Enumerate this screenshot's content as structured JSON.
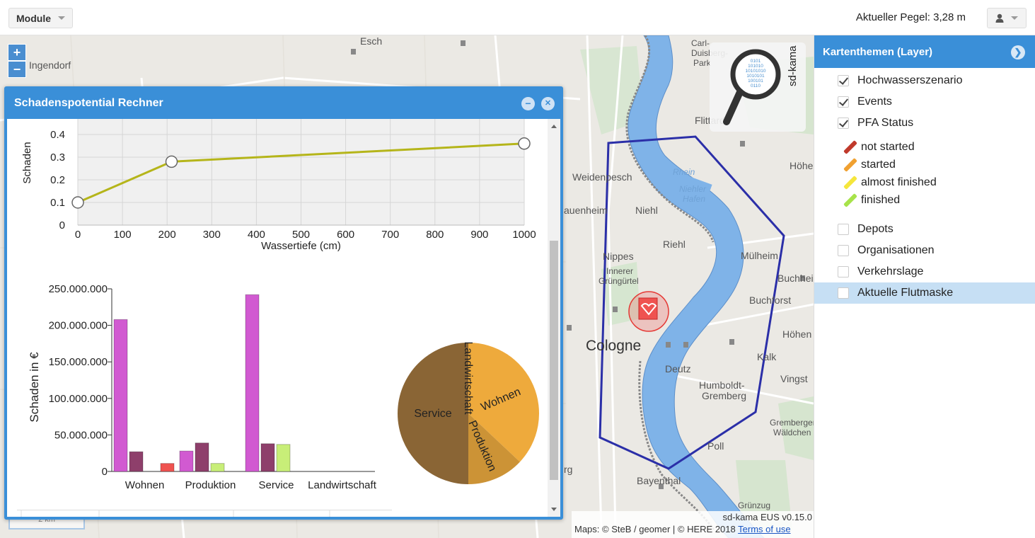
{
  "topbar": {
    "module_label": "Module",
    "pegel": "Aktueller Pegel: 3,28 m"
  },
  "map": {
    "zoom_in": "+",
    "zoom_out": "−",
    "labels": [
      "Esch",
      "Ingendorf",
      "Carl-",
      "Duisberg-",
      "Park",
      "Flittard",
      "Weidenpesch",
      "Höhe",
      "Niehl",
      "auenheim",
      "Riehl",
      "Mülheim",
      "Nippes",
      "Buchheim",
      "Innerer",
      "Grüngürtel",
      "Buchforst",
      "Cologne",
      "Höhen",
      "Kalk",
      "Deutz",
      "Humboldt-",
      "Gremberg",
      "Vingst",
      "Poll",
      "Gremberger",
      "Wäldchen",
      "rg",
      "Bayenthal",
      "Grünzug"
    ],
    "water_labels": [
      "Rhein",
      "Niehler",
      "Hafen"
    ],
    "brand": "sd-kama",
    "version": "sd-kama EUS v0.15.0",
    "attribution": "Maps: © SteB / geomer | © HERE 2018",
    "terms_link": "Terms of use",
    "scale": "2 km"
  },
  "panel": {
    "title": "Kartenthemen (Layer)",
    "layers_top": [
      {
        "label": "Hochwasserszenario",
        "checked": true
      },
      {
        "label": "Events",
        "checked": true
      },
      {
        "label": "PFA Status",
        "checked": true
      }
    ],
    "legend": [
      {
        "label": "not started",
        "color": "#c0392b"
      },
      {
        "label": "started",
        "color": "#f0a030"
      },
      {
        "label": "almost finished",
        "color": "#f5e63c"
      },
      {
        "label": "finished",
        "color": "#a7e34a"
      }
    ],
    "layers_bottom": [
      {
        "label": "Depots",
        "checked": false
      },
      {
        "label": "Organisationen",
        "checked": false
      },
      {
        "label": "Verkehrslage",
        "checked": false
      },
      {
        "label": "Aktuelle Flutmaske",
        "checked": false
      }
    ]
  },
  "dialog": {
    "title": "Schadenspotential Rechner",
    "minimize": "−",
    "close": "✕"
  },
  "chart_data": [
    {
      "type": "line",
      "xlabel": "Wassertiefe (cm)",
      "ylabel": "Schaden",
      "x": [
        0,
        210,
        1000
      ],
      "y": [
        0.1,
        0.28,
        0.36
      ],
      "xlim": [
        0,
        1000
      ],
      "ylim": [
        0,
        0.5
      ],
      "xticks": [
        0,
        100,
        200,
        300,
        400,
        500,
        600,
        700,
        800,
        900,
        1000
      ],
      "yticks": [
        0,
        0.1,
        0.2,
        0.3,
        0.4,
        0.5
      ],
      "color": "#b5b51a"
    },
    {
      "type": "bar",
      "ylabel": "Schaden in €",
      "categories": [
        "Wohnen",
        "Produktion",
        "Service",
        "Landwirtschaft"
      ],
      "series": [
        {
          "values": [
            208000000,
            28000000,
            242000000,
            0
          ],
          "color": "#d15ad1"
        },
        {
          "values": [
            27000000,
            39000000,
            38000000,
            0
          ],
          "color": "#8e3f6b"
        },
        {
          "values": [
            0,
            11000000,
            37000000,
            0
          ],
          "color": "#c8ee78"
        },
        {
          "values": [
            11000000,
            0,
            0,
            0
          ],
          "color": "#ef5350"
        }
      ],
      "ylim": [
        0,
        250000000
      ],
      "yticks": [
        0,
        50000000,
        100000000,
        150000000,
        200000000,
        250000000
      ],
      "ytick_labels": [
        "0",
        "50.000.000",
        "100.000.000",
        "150.000.000",
        "200.000.000",
        "250.000.000"
      ]
    },
    {
      "type": "pie",
      "slices": [
        {
          "label": "Wohnen",
          "value": 37,
          "color": "#eeaa3c"
        },
        {
          "label": "Produktion",
          "value": 13,
          "color": "#cc9336"
        },
        {
          "label": "Service",
          "value": 50,
          "color": "#8a6535"
        },
        {
          "label": "Landwirtschaft",
          "value": 0,
          "color": "#6a4a22"
        }
      ]
    }
  ]
}
